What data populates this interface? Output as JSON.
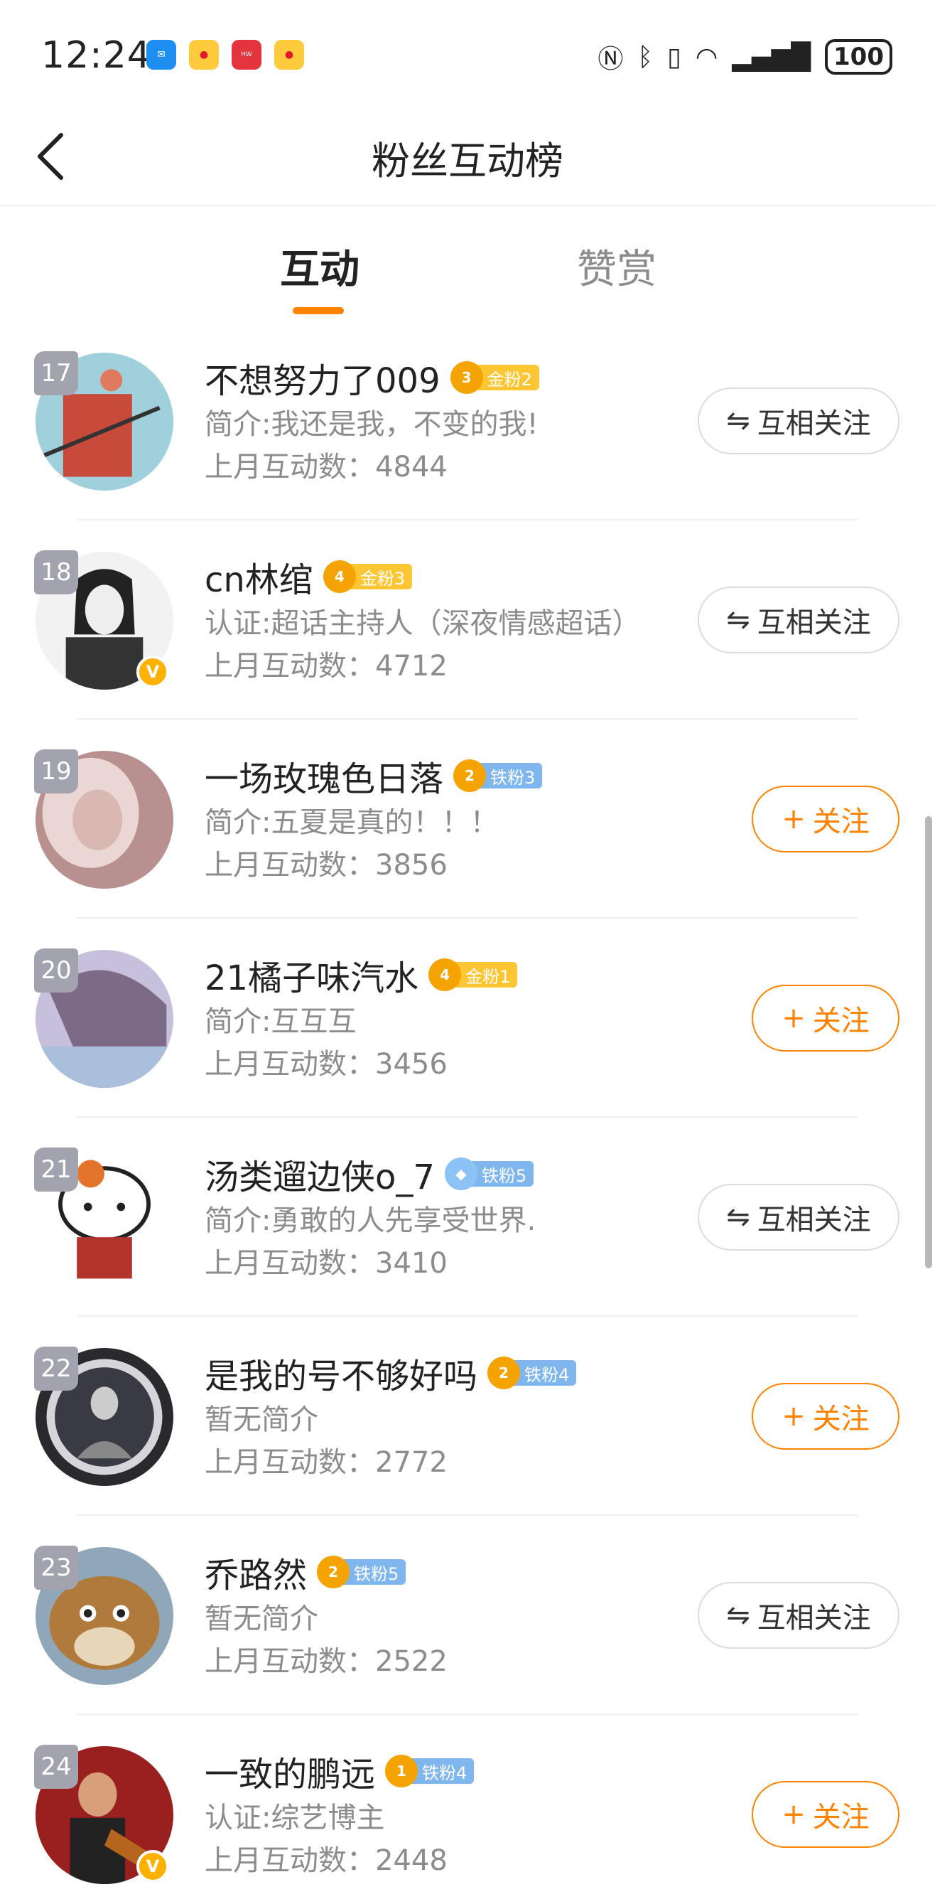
{
  "status_bar": {
    "time": "12:24",
    "battery": "100",
    "app_icons": [
      "message-app-icon",
      "weibo-app-icon",
      "huawei-app-icon",
      "weibo-app-icon"
    ]
  },
  "header": {
    "title": "粉丝互动榜"
  },
  "tabs": [
    {
      "label": "互动",
      "active": true
    },
    {
      "label": "赞赏",
      "active": false
    }
  ],
  "colors": {
    "accent": "#ff8200",
    "secondary_text": "#8c8c8c",
    "gold_badge": "#ffc634",
    "iron_badge": "#7fb6ee",
    "rank_badge": "#a3a3b0"
  },
  "users": [
    {
      "rank": "17",
      "name": "不想努力了009",
      "crown": "3",
      "badge": "金粉2",
      "badge_type": "gold",
      "bio": "简介:我还是我，不变的我!",
      "count": "上月互动数：4844",
      "button": "互相关注",
      "button_type": "mutual",
      "verified": false
    },
    {
      "rank": "18",
      "name": "cn林绾",
      "crown": "4",
      "badge": "金粉3",
      "badge_type": "gold",
      "bio": "认证:超话主持人（深夜情感超话）",
      "count": "上月互动数：4712",
      "button": "互相关注",
      "button_type": "mutual",
      "verified": true
    },
    {
      "rank": "19",
      "name": "一场玫瑰色日落",
      "crown": "2",
      "badge": "铁粉3",
      "badge_type": "iron",
      "bio": "简介:五夏是真的！！！",
      "count": "上月互动数：3856",
      "button": "关注",
      "button_type": "follow",
      "verified": false
    },
    {
      "rank": "20",
      "name": "21橘子味汽水",
      "crown": "4",
      "badge": "金粉1",
      "badge_type": "gold",
      "bio": "简介:互互互",
      "count": "上月互动数：3456",
      "button": "关注",
      "button_type": "follow",
      "verified": false
    },
    {
      "rank": "21",
      "name": "汤类遛边侠o_7",
      "crown": "",
      "badge": "铁粉5",
      "badge_type": "diamond",
      "bio": "简介:勇敢的人先享受世界.",
      "count": "上月互动数：3410",
      "button": "互相关注",
      "button_type": "mutual",
      "verified": false
    },
    {
      "rank": "22",
      "name": "是我的号不够好吗",
      "crown": "2",
      "badge": "铁粉4",
      "badge_type": "iron",
      "bio": "暂无简介",
      "count": "上月互动数：2772",
      "button": "关注",
      "button_type": "follow",
      "verified": false
    },
    {
      "rank": "23",
      "name": "乔路然",
      "crown": "2",
      "badge": "铁粉5",
      "badge_type": "iron",
      "bio": "暂无简介",
      "count": "上月互动数：2522",
      "button": "互相关注",
      "button_type": "mutual",
      "verified": false
    },
    {
      "rank": "24",
      "name": "一致的鹏远",
      "crown": "1",
      "badge": "铁粉4",
      "badge_type": "iron",
      "bio": "认证:综艺博主",
      "count": "上月互动数：2448",
      "button": "关注",
      "button_type": "follow",
      "verified": true
    }
  ]
}
